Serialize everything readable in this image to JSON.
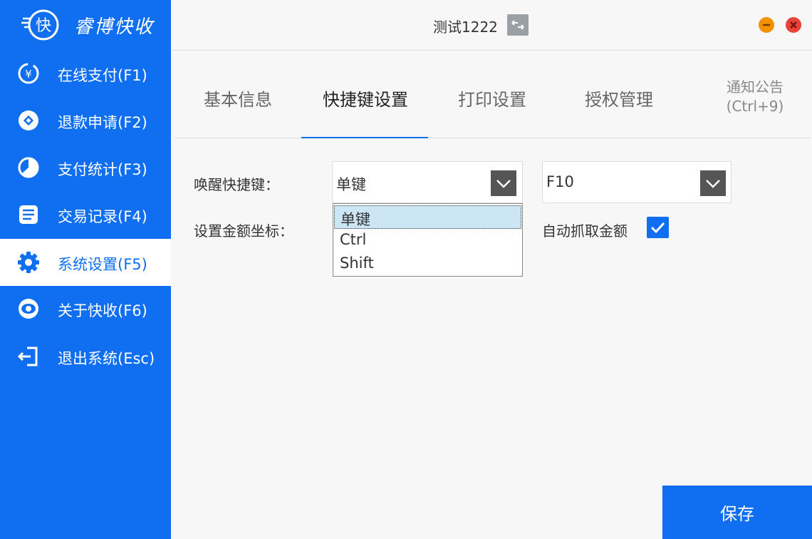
{
  "brand": {
    "name": "睿博快收",
    "logo_char": "快"
  },
  "sidebar": {
    "items": [
      {
        "label": "在线支付(F1)",
        "icon": "yen-refresh-icon"
      },
      {
        "label": "退款申请(F2)",
        "icon": "diamond-icon"
      },
      {
        "label": "支付统计(F3)",
        "icon": "pie-chart-icon"
      },
      {
        "label": "交易记录(F4)",
        "icon": "document-list-icon"
      },
      {
        "label": "系统设置(F5)",
        "icon": "gear-icon",
        "active": true
      },
      {
        "label": "关于快收(F6)",
        "icon": "eye-icon"
      },
      {
        "label": "退出系统(Esc)",
        "icon": "logout-icon"
      }
    ]
  },
  "topbar": {
    "title": "测试1222"
  },
  "tabs": {
    "items": [
      "基本信息",
      "快捷键设置",
      "打印设置",
      "授权管理"
    ],
    "notice_line1": "通知公告",
    "notice_line2": "(Ctrl+9)",
    "active_index": 1
  },
  "form": {
    "wake_label": "唤醒快捷键：",
    "modifier_value": "单键",
    "key_value": "F10",
    "amount_coord_label": "设置金额坐标：",
    "auto_capture_label": "自动抓取金额",
    "auto_capture_checked": true,
    "modifier_options": [
      "单键",
      "Ctrl",
      "Shift"
    ],
    "selected_option": "单键"
  },
  "save_label": "保存",
  "colors": {
    "accent": "#0f6ff0",
    "minimize": "#f39200",
    "close": "#e84338"
  }
}
